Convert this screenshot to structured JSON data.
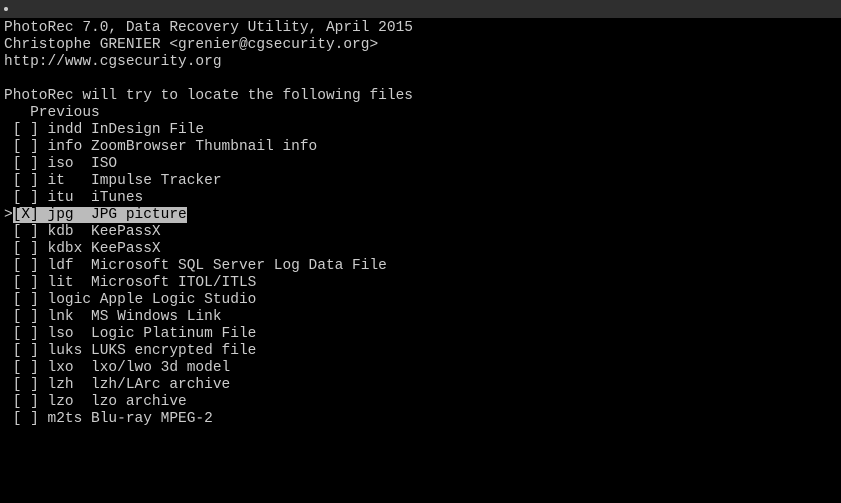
{
  "header": {
    "line1": "PhotoRec 7.0, Data Recovery Utility, April 2015",
    "line2": "Christophe GRENIER <grenier@cgsecurity.org>",
    "line3": "http://www.cgsecurity.org"
  },
  "prompt": "PhotoRec will try to locate the following files",
  "previous_label": "   Previous",
  "cursor": ">",
  "items": [
    {
      "checked": " ",
      "ext": "indd ",
      "desc": "InDesign File",
      "selected": false
    },
    {
      "checked": " ",
      "ext": "info ",
      "desc": "ZoomBrowser Thumbnail info",
      "selected": false
    },
    {
      "checked": " ",
      "ext": "iso  ",
      "desc": "ISO",
      "selected": false
    },
    {
      "checked": " ",
      "ext": "it   ",
      "desc": "Impulse Tracker",
      "selected": false
    },
    {
      "checked": " ",
      "ext": "itu  ",
      "desc": "iTunes",
      "selected": false
    },
    {
      "checked": "X",
      "ext": "jpg  ",
      "desc": "JPG picture",
      "selected": true
    },
    {
      "checked": " ",
      "ext": "kdb  ",
      "desc": "KeePassX",
      "selected": false
    },
    {
      "checked": " ",
      "ext": "kdbx ",
      "desc": "KeePassX",
      "selected": false
    },
    {
      "checked": " ",
      "ext": "ldf  ",
      "desc": "Microsoft SQL Server Log Data File",
      "selected": false
    },
    {
      "checked": " ",
      "ext": "lit  ",
      "desc": "Microsoft ITOL/ITLS",
      "selected": false
    },
    {
      "checked": " ",
      "ext": "logic",
      "desc": " Apple Logic Studio",
      "selected": false
    },
    {
      "checked": " ",
      "ext": "lnk  ",
      "desc": "MS Windows Link",
      "selected": false
    },
    {
      "checked": " ",
      "ext": "lso  ",
      "desc": "Logic Platinum File",
      "selected": false
    },
    {
      "checked": " ",
      "ext": "luks ",
      "desc": "LUKS encrypted file",
      "selected": false
    },
    {
      "checked": " ",
      "ext": "lxo  ",
      "desc": "lxo/lwo 3d model",
      "selected": false
    },
    {
      "checked": " ",
      "ext": "lzh  ",
      "desc": "lzh/LArc archive",
      "selected": false
    },
    {
      "checked": " ",
      "ext": "lzo  ",
      "desc": "lzo archive",
      "selected": false
    },
    {
      "checked": " ",
      "ext": "m2ts ",
      "desc": "Blu-ray MPEG-2",
      "selected": false
    }
  ]
}
